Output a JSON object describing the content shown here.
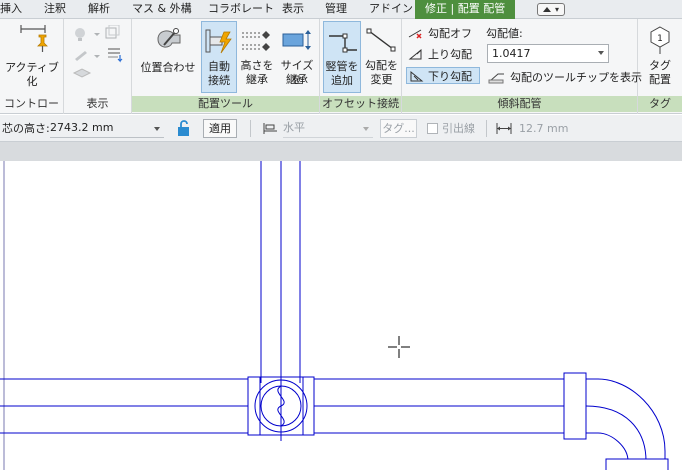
{
  "tabs": [
    {
      "label": "挿入"
    },
    {
      "label": "注釈"
    },
    {
      "label": "解析"
    },
    {
      "label": "マス & 外構"
    },
    {
      "label": "コラボレート"
    },
    {
      "label": "表示"
    },
    {
      "label": "管理"
    },
    {
      "label": "アドイン"
    },
    {
      "label": "修正 | 配置 配管",
      "active": true
    }
  ],
  "ribbon": {
    "panels": {
      "control": "コントロール",
      "view": "表示",
      "placement_tools": "配置ツール",
      "offset_connect": "オフセット接続",
      "sloped_pipe": "傾斜配管",
      "tag": "タグ"
    },
    "tools": {
      "activate": "アクティブ化",
      "justify": "位置合わせ",
      "auto_connect": [
        "自動",
        "接続"
      ],
      "inherit_elevation": [
        "高さを",
        "継承"
      ],
      "inherit_size": [
        "サイズを",
        "継承"
      ],
      "add_vertical": [
        "竪管を",
        "追加"
      ],
      "change_slope": [
        "勾配を",
        "変更"
      ],
      "slope_off": "勾配オフ",
      "slope_up": "上り勾配",
      "slope_down": "下り勾配",
      "slope_value_label": "勾配値:",
      "slope_value": "1.0417",
      "slope_tooltip": "勾配のツールチップを表示",
      "tag_on_placement": [
        "タグ",
        "配置"
      ]
    }
  },
  "options_bar": {
    "offset_label": "芯の高さ:",
    "offset_value": "2743.2 mm",
    "apply": "適用",
    "direction": "水平",
    "tag": "タグ...",
    "leader": "引出線",
    "leader_length": "12.7 mm"
  },
  "colors": {
    "active_tab": "#4e8f3e",
    "context_panel_title": "#c8dfbd",
    "pipe": "#0000cc",
    "pressed": "#cfe4f5"
  }
}
